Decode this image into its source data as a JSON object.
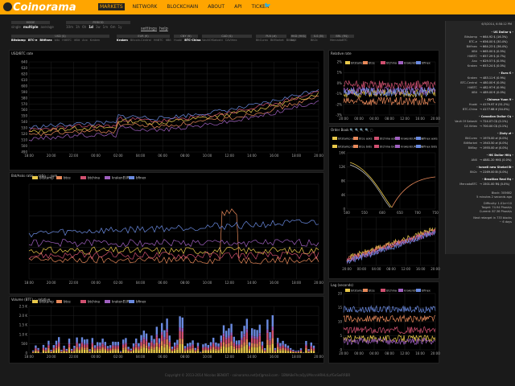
{
  "brand": {
    "name": "Coinorama"
  },
  "nav": [
    {
      "label": "MARKETS",
      "active": true
    },
    {
      "label": "NETWORK"
    },
    {
      "label": "BLOCKCHAIN"
    },
    {
      "label": "ABOUT"
    },
    {
      "label": "API"
    },
    {
      "label": "TICKER"
    }
  ],
  "controls": {
    "mode": {
      "header": "MODE",
      "options": [
        "single",
        "multiple",
        "average"
      ],
      "selected": "multiple"
    },
    "period": {
      "header": "PERIOD",
      "options": [
        "10m",
        "1h",
        "6h",
        "1d",
        "1w",
        "1m",
        "6m",
        "1y"
      ],
      "selected": "1d"
    },
    "links": [
      "settings",
      "help"
    ],
    "currencies": [
      {
        "header": "USD ($)",
        "exchanges": [
          "Bitstamp",
          "BTC-e",
          "Bitfinex",
          "bitx",
          "HitBTC",
          "itBit",
          "Anx",
          "Kraken"
        ]
      },
      {
        "header": "EUR (€)",
        "exchanges": [
          "Kraken",
          "Bitcoin-Central",
          "HitBTC",
          "itBit"
        ]
      },
      {
        "header": "CNY (¥)",
        "exchanges": [
          "Huobi",
          "BTC-China"
        ]
      },
      {
        "header": "CAD ($)",
        "exchanges": [
          "VaultOfSatoshi",
          "CAVirtex"
        ]
      },
      {
        "header": "PLN (zł)",
        "exchanges": [
          "BitCurex",
          "BitMarket",
          "BitBay"
        ]
      },
      {
        "header": "HKD (HK$)",
        "exchanges": [
          "ANX"
        ]
      },
      {
        "header": "ILS (₪)",
        "exchanges": [
          "Bit2c"
        ]
      },
      {
        "header": "BRL (R$)",
        "exchanges": [
          "MercadoBTC"
        ]
      }
    ],
    "selected_exchanges": [
      "Bitstamp",
      "BTC-e",
      "Bitfinex",
      "Kraken",
      "BTC-China"
    ]
  },
  "colors": {
    "bitstamp": "#e8c84a",
    "btce": "#e8895a",
    "bfchina": "#d05070",
    "krakenEUR": "#a060c0",
    "bfinex": "#6a8ae0",
    "accent": "#ffa500"
  },
  "legend": [
    "bitstamp",
    "btce",
    "btchina",
    "krakenEUR",
    "bfinex"
  ],
  "panels": {
    "price": {
      "title": "USD/BTC rate",
      "yticks": [
        "640",
        "630",
        "620",
        "610",
        "600",
        "590",
        "580",
        "570",
        "560",
        "550",
        "540",
        "530",
        "520",
        "510",
        "500",
        "490"
      ]
    },
    "bidask": {
      "title": "Bid/Asks ratio",
      "options": [
        "ratio",
        "sum"
      ]
    },
    "volume": {
      "title": "Volume (BTC)",
      "options": [
        "relative"
      ],
      "yticks": [
        "2.5 K",
        "2.0 K",
        "1.5 K",
        "1.0 K",
        "500",
        "0"
      ]
    },
    "relative": {
      "title": "Relative rate",
      "yticks": [
        "2%",
        "1%",
        "0%",
        "-1%",
        "-2%",
        "-3%"
      ]
    },
    "orderbook": {
      "title": "Order Book",
      "legend": [
        "bitstamp asks",
        "btce asks",
        "btchina asks",
        "krakenEUR asks",
        "bfinex asks",
        "bitstamp bids",
        "btce bids",
        "btchina bids",
        "krakenEUR bids",
        "bfinex bids"
      ],
      "yticks": [
        "16K",
        "12K",
        "8K",
        "4K",
        "0"
      ],
      "xticks": [
        "500",
        "550",
        "600",
        "650",
        "700",
        "750"
      ]
    },
    "lag": {
      "title": "Lag (seconds)",
      "yticks": [
        "20",
        "15",
        "10",
        "5",
        "0"
      ]
    },
    "xticks": [
      "18:00",
      "20:00",
      "22:00",
      "00:00",
      "02:00",
      "04:00",
      "06:00",
      "08:00",
      "10:00",
      "12:00",
      "14:00",
      "16:00",
      "18:00",
      "20:00"
    ],
    "xticks_small": [
      "20:00",
      "00:00",
      "04:00",
      "08:00",
      "12:00",
      "16:00",
      "20:00"
    ]
  },
  "sidebar": {
    "timestamp": "6/3/2014, 6:58:12 PM",
    "groups": [
      {
        "title": "- US Dollar $ -",
        "rows": [
          {
            "k": "Bitstamp",
            "v": "664.92 $ (16.3%)"
          },
          {
            "k": "BTC-e",
            "v": "656.00 $ (30.4%)"
          },
          {
            "k": "Bitfinex",
            "v": "664.23 $ (36.4%)"
          },
          {
            "k": "itBit",
            "v": "665.00 $ (0.5%)"
          },
          {
            "k": "HitBTC",
            "v": "657.29 $ (0.7%)"
          },
          {
            "k": "Anx",
            "v": "629.57 $ (0.5%)"
          },
          {
            "k": "Kraken",
            "v": "653.24 $ (0.0%)"
          }
        ]
      },
      {
        "title": "- Euro € -",
        "rows": [
          {
            "k": "Kraken",
            "v": "483.11 € (0.9%)"
          },
          {
            "k": "BTC-Central",
            "v": "480.00 € (0.0%)"
          },
          {
            "k": "HitBTC",
            "v": "482.97 € (0.9%)"
          },
          {
            "k": "itBit",
            "v": "489.00 € (0.0%)"
          }
        ]
      },
      {
        "title": "- Chinese Yuan ¥ -",
        "rows": [
          {
            "k": "Huobi",
            "v": "4179.97 ¥ (51.2%)"
          },
          {
            "k": "BTC-China",
            "v": "4177.68 ¥ (54.0%)"
          }
        ]
      },
      {
        "title": "- Canadian Dollar C$ -",
        "rows": [
          {
            "k": "Vault Of Satoshi",
            "v": "724.07 C$ (0.1%)"
          },
          {
            "k": "CA Virtex",
            "v": "700.00 C$ (0.1%)"
          }
        ]
      },
      {
        "title": "- Zloty zł -",
        "rows": [
          {
            "k": "BitCurex",
            "v": "1970.00 zł (0.0%)"
          },
          {
            "k": "BitMarket",
            "v": "1943.50 zł (0.0%)"
          },
          {
            "k": "BitBay",
            "v": "1955.00 zł (0.0%)"
          }
        ]
      },
      {
        "title": "- HK Dollar HK$ -",
        "rows": [
          {
            "k": "ANX",
            "v": "4881.20 HK$ (0.0%)"
          }
        ]
      },
      {
        "title": "- Israeli new Shekel ₪ -",
        "rows": [
          {
            "k": "Bit2c",
            "v": "2269.00 ₪ (0.0%)"
          }
        ]
      },
      {
        "title": "- Brazilian Real R$ -",
        "rows": [
          {
            "k": "MercadoBTC",
            "v": "1501.00 R$ (0.0%)"
          }
        ]
      }
    ],
    "block": [
      "Block: 305682",
      "5 minutes 2 seconds ago",
      "",
      "Difficulty: 1.01e+10",
      "Target: 74.94 Phash/s",
      "Current: 87.36 Phash/s",
      "",
      "Next retarget in 733 blocks",
      "~ 6 days"
    ]
  },
  "footer": "Copyright © 2013-2014 Nicolas BENOIT - coinorama.net[at]gmail.com · 1BNA8eFhcaQyUMnnnHRHLtLzfGeSwRRBR"
}
